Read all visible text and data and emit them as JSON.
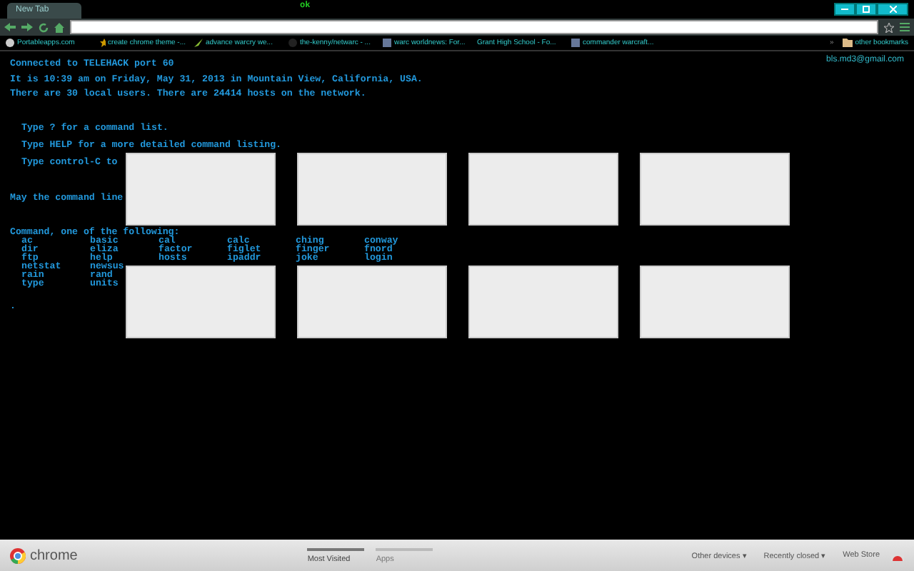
{
  "theme_text": {
    "top": "ok"
  },
  "window": {
    "tabs": [
      {
        "label": "New Tab",
        "selected": true
      }
    ]
  },
  "bookmarks": [
    {
      "label": "Portableapps.com",
      "kind": "globe"
    },
    {
      "label": "create chrome theme -...",
      "kind": "star"
    },
    {
      "label": "advance warcry we...",
      "kind": "leaf"
    },
    {
      "label": "the-kenny/netwarc - ...",
      "kind": "dot"
    },
    {
      "label": "warc worldnews: For...",
      "kind": "image"
    },
    {
      "label": "Grant High School - Fo...",
      "kind": "none"
    },
    {
      "label": "commander warcraft...",
      "kind": "image"
    }
  ],
  "overflow": "»",
  "other_bookmarks": "other bookmarks",
  "account": "bls.md3@gmail.com",
  "terminal": {
    "lines": [
      "Connected to TELEHACK port 60",
      "It is 10:39 am on Friday, May 31, 2013 in Mountain View, California, USA.",
      "There are 30 local users. There are 24414 hosts on the network."
    ],
    "hints": [
      "Type ? for a command list.",
      "Type HELP for a more detailed command listing.",
      "Type control-C to"
    ],
    "motd": "May the command line",
    "heading": "Command, one of the following:",
    "commands": [
      [
        "ac",
        "basic",
        "cal",
        "calc",
        "ching",
        "conway"
      ],
      [
        "dir",
        "eliza",
        "factor",
        "figlet",
        "finger",
        "fnord"
      ],
      [
        "ftp",
        "help",
        "hosts",
        "ipaddr",
        "joke",
        "login"
      ],
      [
        "netstat",
        "newsus"
      ],
      [
        "rain",
        "rand"
      ],
      [
        "type",
        "units"
      ]
    ],
    "prompt": "."
  },
  "tiles": [
    {
      "kind": "blank"
    },
    {
      "kind": "blank"
    },
    {
      "kind": "blank"
    },
    {
      "kind": "blank"
    },
    {
      "kind": "blank"
    },
    {
      "kind": "blank"
    },
    {
      "kind": "blank"
    },
    {
      "kind": "blank"
    }
  ],
  "footer": {
    "brand": "chrome",
    "sections": [
      {
        "label": "Most Visited",
        "selected": true
      },
      {
        "label": "Apps",
        "selected": false
      }
    ],
    "menus": [
      "Other devices ▾",
      "Recently closed ▾"
    ],
    "store": "Web Store"
  }
}
